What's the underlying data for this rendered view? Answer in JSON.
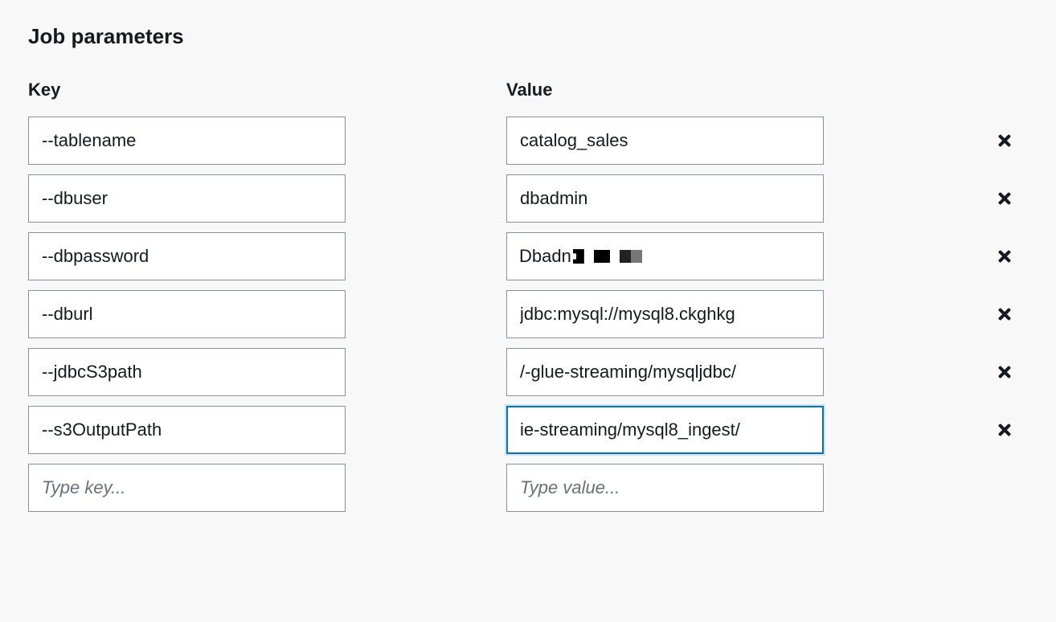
{
  "section": {
    "title": "Job parameters",
    "key_header": "Key",
    "value_header": "Value",
    "key_placeholder": "Type key...",
    "value_placeholder": "Type value..."
  },
  "parameters": [
    {
      "key": "--tablename",
      "value": "catalog_sales"
    },
    {
      "key": "--dbuser",
      "value": "dbadmin"
    },
    {
      "key": "--dbpassword",
      "value": "Dbadn",
      "obscured": true
    },
    {
      "key": "--dburl",
      "value": "jdbc:mysql://mysql8.ckghkg"
    },
    {
      "key": "--jdbcS3path",
      "value": "/-glue-streaming/mysqljdbc/"
    },
    {
      "key": "--s3OutputPath",
      "value": "ie-streaming/mysql8_ingest/",
      "focused": true
    }
  ]
}
